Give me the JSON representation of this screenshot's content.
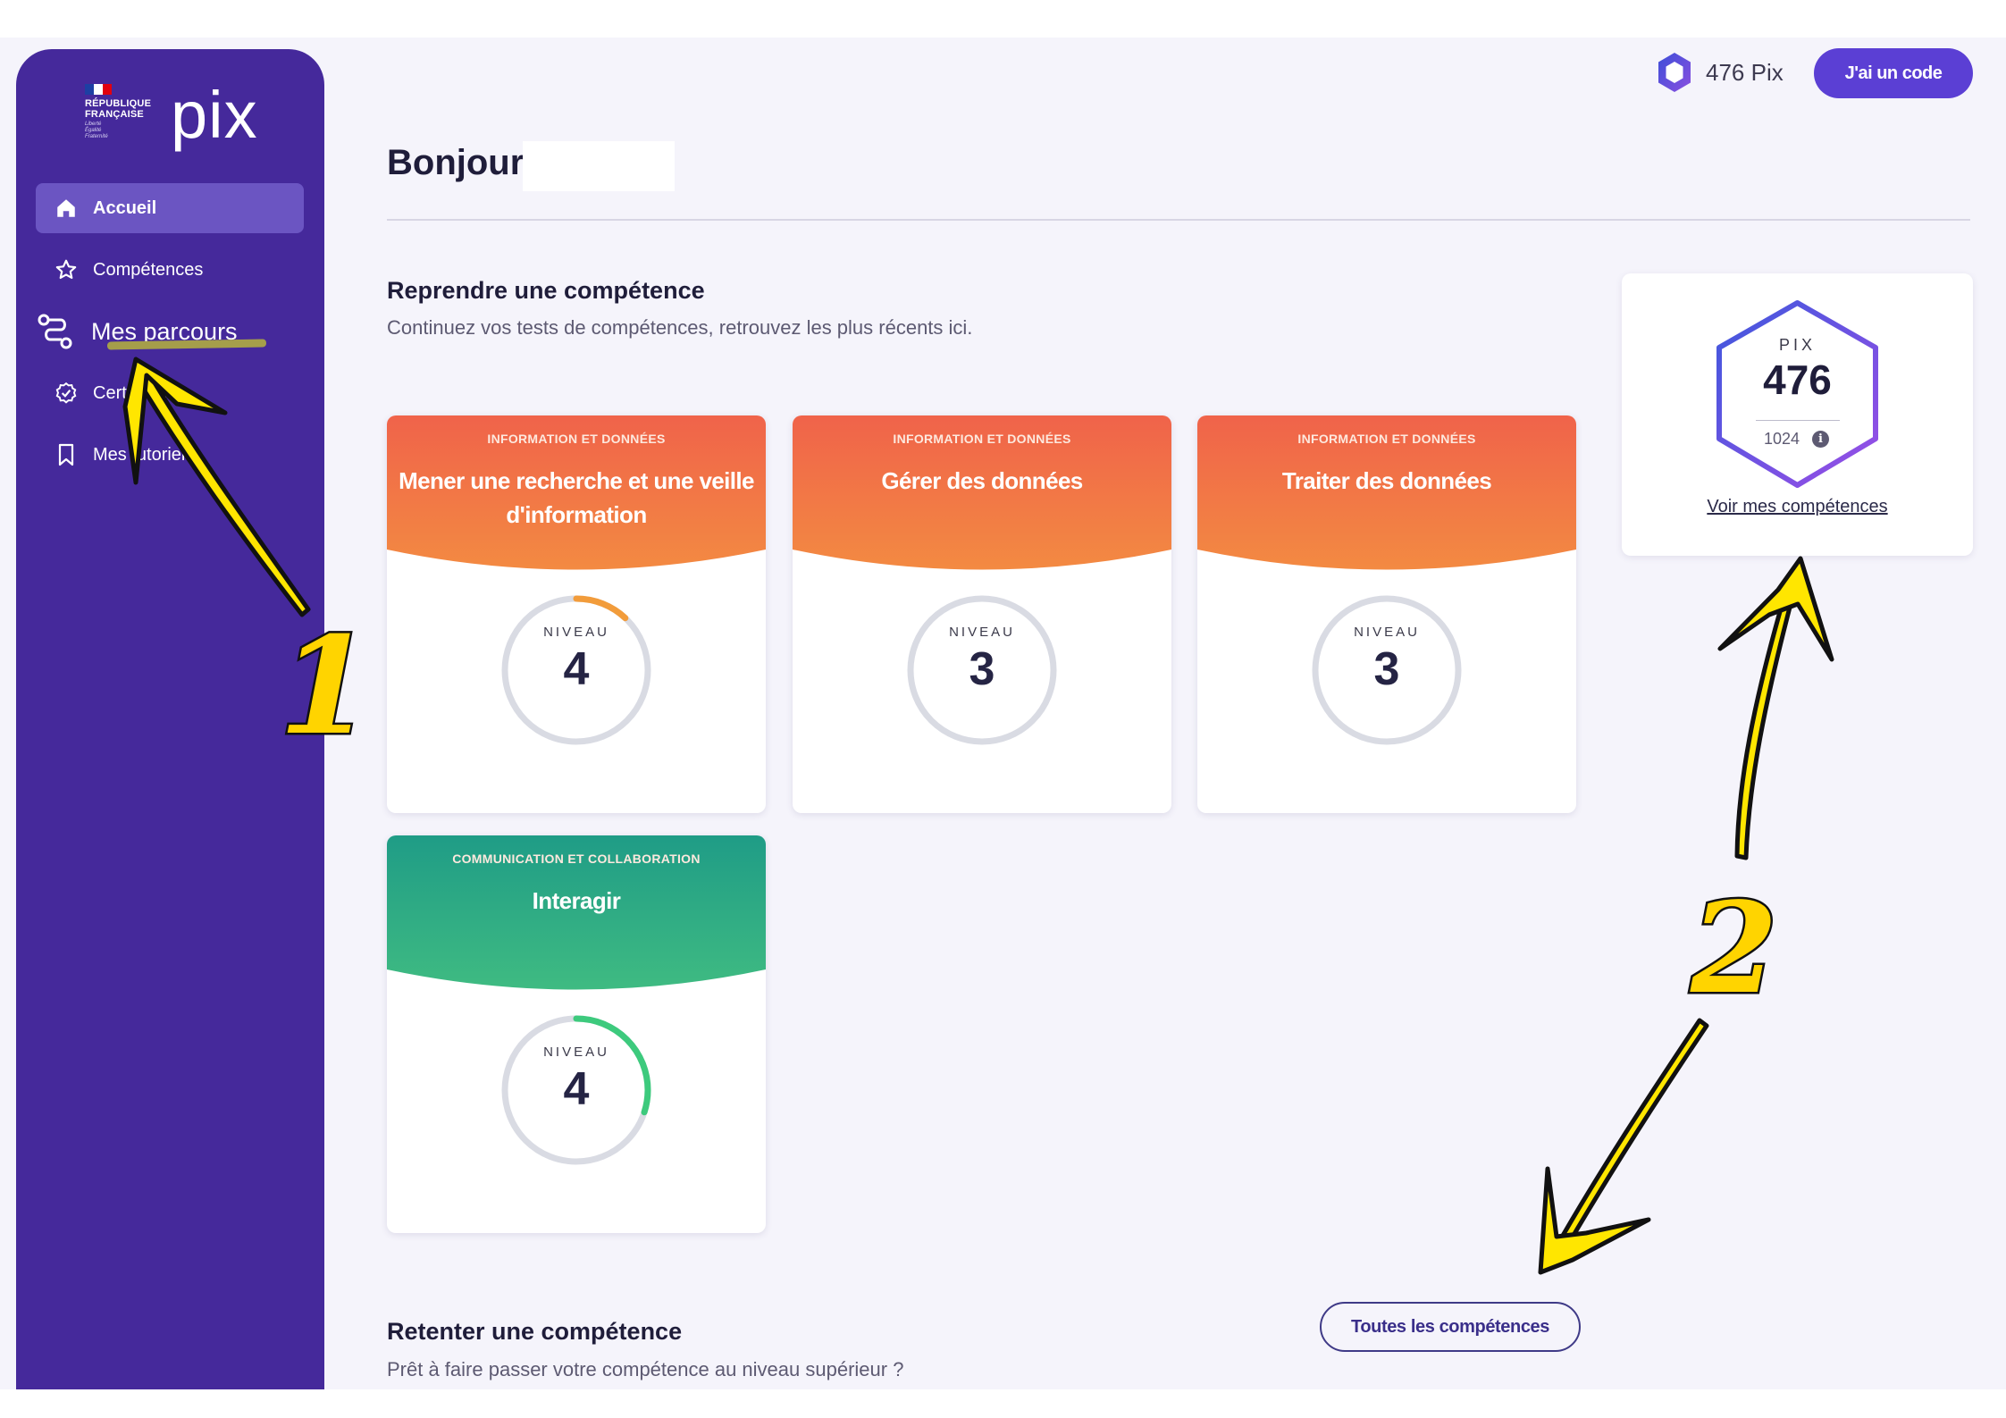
{
  "brand": {
    "republique_lines": [
      "RÉPUBLIQUE",
      "FRANÇAISE"
    ],
    "motto_lines": [
      "Liberté",
      "Égalité",
      "Fraternité"
    ],
    "app_name": "pix",
    "flag_colors": [
      "#1d3fa3",
      "#ffffff",
      "#e1000f"
    ]
  },
  "sidebar": {
    "items": [
      {
        "label": "Accueil",
        "icon": "home-icon",
        "active": true
      },
      {
        "label": "Compétences",
        "icon": "star-icon",
        "active": false
      },
      {
        "label": "Mes parcours",
        "icon": "route-icon",
        "active": false
      },
      {
        "label": "Certification",
        "icon": "check-badge-icon",
        "active": false
      },
      {
        "label": "Mes tutoriels",
        "icon": "bookmark-icon",
        "active": false
      }
    ]
  },
  "topbar": {
    "score_label": "476 Pix",
    "code_button": "J'ai un code"
  },
  "header": {
    "greeting": "Bonjour"
  },
  "resume": {
    "title": "Reprendre une compétence",
    "subtitle": "Continuez vos tests de compétences, retrouvez les plus récents ici.",
    "niveau_label": "NIVEAU",
    "cards": [
      {
        "domain": "INFORMATION ET DONNÉES",
        "name": "Mener une recherche et une veille d'information",
        "level": "4",
        "progress": 0.12,
        "progress_color": "#f29c3b",
        "band_from": "#f0634a",
        "band_to": "#f38a42"
      },
      {
        "domain": "INFORMATION ET DONNÉES",
        "name": "Gérer des données",
        "level": "3",
        "progress": 0,
        "progress_color": "#f29c3b",
        "band_from": "#f0634a",
        "band_to": "#f38a42"
      },
      {
        "domain": "INFORMATION ET DONNÉES",
        "name": "Traiter des données",
        "level": "3",
        "progress": 0,
        "progress_color": "#f29c3b",
        "band_from": "#f0634a",
        "band_to": "#f38a42"
      },
      {
        "domain": "COMMUNICATION ET COLLABORATION",
        "name": "Interagir",
        "level": "4",
        "progress": 0.3,
        "progress_color": "#3dca7d",
        "band_from": "#1f9c86",
        "band_to": "#3fbb82"
      }
    ]
  },
  "score_panel": {
    "pix_label": "PIX",
    "pix_value": "476",
    "max_value": "1024",
    "info_icon": "info-icon",
    "link_label": "Voir mes compétences"
  },
  "retry": {
    "title": "Retenter une compétence",
    "subtitle": "Prêt à faire passer votre compétence au niveau supérieur ?",
    "all_button": "Toutes les compétences"
  },
  "annotations": {
    "number_1": "1",
    "number_2": "2",
    "arrow_color": "#ffe600"
  }
}
